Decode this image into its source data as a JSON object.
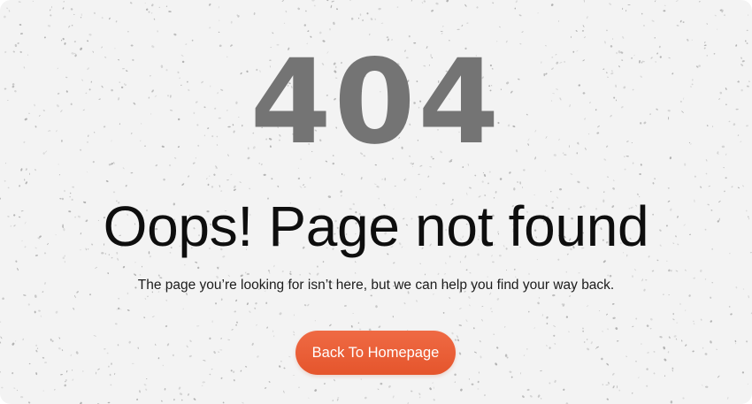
{
  "error": {
    "code": "404",
    "headline": "Oops! Page not found",
    "message": "The page you’re looking for isn’t here, but we can help you find your way back."
  },
  "actions": {
    "home_button_label": "Back To Homepage"
  },
  "colors": {
    "background": "#f3f3f3",
    "code_text": "#747474",
    "headline_text": "#0e0e0e",
    "button": "#e95e36",
    "button_text": "#ffffff"
  }
}
